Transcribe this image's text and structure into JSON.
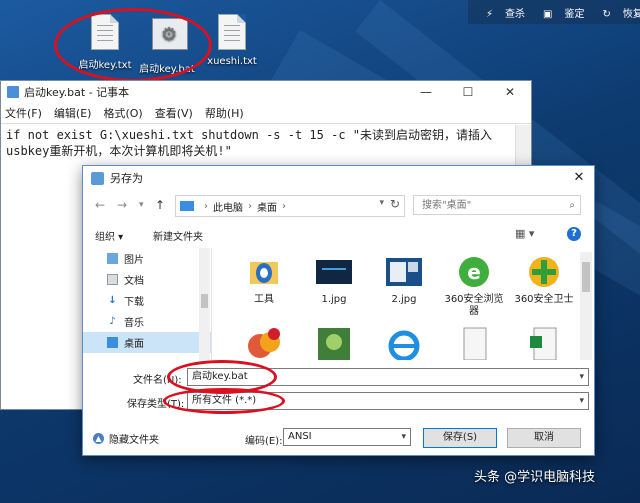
{
  "desktop": {
    "icons": [
      {
        "label": "启动key.txt",
        "icon": "text-file-icon"
      },
      {
        "label": "启动key.bat",
        "icon": "batch-file-icon"
      },
      {
        "label": "xueshi.txt",
        "icon": "text-file-icon"
      }
    ],
    "toolbar": {
      "items": [
        "查杀",
        "鉴定",
        "恢复"
      ]
    }
  },
  "notepad": {
    "title": "启动key.bat - 记事本",
    "menu": [
      "文件(F)",
      "编辑(E)",
      "格式(O)",
      "查看(V)",
      "帮助(H)"
    ],
    "content": "if not exist G:\\xueshi.txt shutdown -s -t 15 -c \"未读到启动密钥，请插入usbkey重新开机，本次计算机即将关机!\""
  },
  "save_dialog": {
    "title": "另存为",
    "breadcrumb": [
      "此电脑",
      "桌面"
    ],
    "search_placeholder": "搜索\"桌面\"",
    "organize": "组织 ▾",
    "new_folder": "新建文件夹",
    "sidebar": [
      {
        "label": "图片",
        "icon": "pictures-icon"
      },
      {
        "label": "文档",
        "icon": "documents-icon"
      },
      {
        "label": "下载",
        "icon": "downloads-icon"
      },
      {
        "label": "音乐",
        "icon": "music-icon"
      },
      {
        "label": "桌面",
        "icon": "desktop-icon",
        "selected": true
      }
    ],
    "files_row1": [
      "工具",
      "1.jpg",
      "2.jpg",
      "360安全浏览器",
      "360安全卫士"
    ],
    "filename_label": "文件名(N):",
    "filename_value": "启动key.bat",
    "savetype_label": "保存类型(T):",
    "savetype_value": "所有文件 (*.*)",
    "hide_folders": "隐藏文件夹",
    "encoding_label": "编码(E):",
    "encoding_value": "ANSI",
    "save_button": "保存(S)",
    "cancel_button": "取消"
  },
  "watermark": "头条 @学识电脑科技",
  "colors": {
    "highlight_ring": "#d9101f",
    "accent": "#0078d7"
  }
}
